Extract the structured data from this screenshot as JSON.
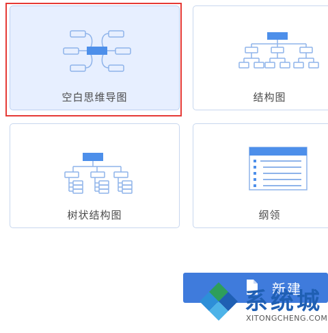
{
  "templates": [
    {
      "label": "空白思维导图",
      "icon": "mind-map-icon",
      "selected": true
    },
    {
      "label": "结构图",
      "icon": "structure-chart-icon",
      "selected": false
    },
    {
      "label": "树状结构图",
      "icon": "tree-chart-icon",
      "selected": false
    },
    {
      "label": "纲领",
      "icon": "outline-icon",
      "selected": false
    }
  ],
  "new_button": {
    "label": "新建",
    "icon": "document-icon"
  },
  "watermark": {
    "text": "系统城",
    "subtext": "XITONGCHENG.COM",
    "icon": "diamond-logo-icon"
  },
  "colors": {
    "accent": "#3f7bdc",
    "selected_bg": "#e7efff",
    "highlight": "#e53935",
    "icon_stroke": "#8eb3ea",
    "icon_fill": "#4d8fea"
  }
}
